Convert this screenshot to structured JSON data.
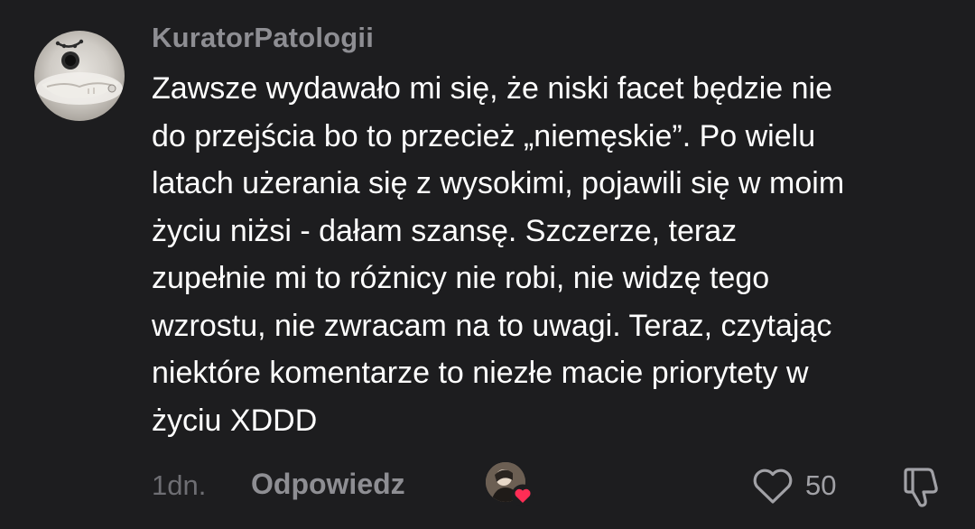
{
  "comment": {
    "username": "KuratorPatologii",
    "text": "Zawsze wydawało mi się, że niski facet będzie nie\ndo przejścia bo to przecież „niemęskie”. Po wielu\nlatach użerania się z wysokimi, pojawili się w moim\nżyciu niżsi - dałam szansę. Szczerze, teraz\nzupełnie mi to różnicy nie robi, nie widzę tego\nwzrostu, nie zwracam na to uwagi. Teraz, czytając\nniektóre komentarze to niezłe macie priorytety w\nżyciu XDDD",
    "time": "1dn.",
    "reply_label": "Odpowiedz",
    "like_count": "50"
  },
  "colors": {
    "background": "#1d1d1f",
    "text": "#ffffff",
    "muted": "#8e8e93",
    "heart_accent": "#ff2d55"
  },
  "icons": {
    "like": "heart-outline-icon",
    "dislike": "thumbs-down-icon",
    "reaction": "heart-filled-icon"
  }
}
